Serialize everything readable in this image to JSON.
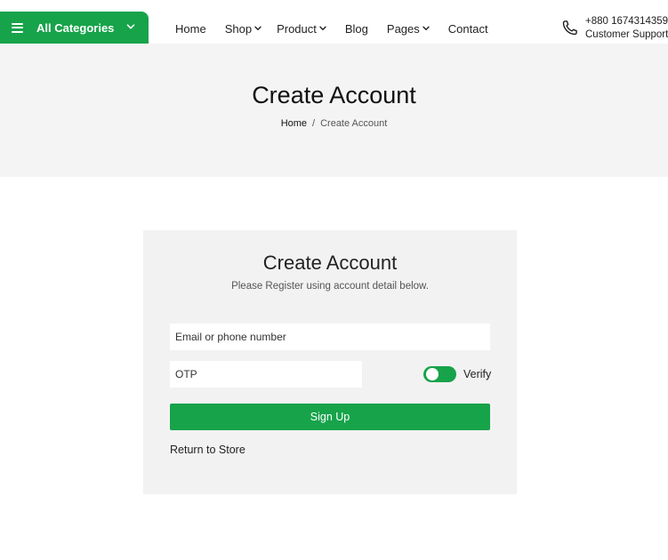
{
  "header": {
    "categories_label": "All Categories",
    "nav": [
      {
        "label": "Home",
        "has_caret": false
      },
      {
        "label": "Shop",
        "has_caret": true
      },
      {
        "label": "Product",
        "has_caret": true
      },
      {
        "label": "Blog",
        "has_caret": false
      },
      {
        "label": "Pages",
        "has_caret": true
      },
      {
        "label": "Contact",
        "has_caret": false
      }
    ],
    "support": {
      "phone": "+880 1674314359",
      "label": "Customer Support",
      "icon": "phone-icon"
    }
  },
  "banner": {
    "title": "Create Account",
    "breadcrumb": {
      "home": "Home",
      "separator": "/",
      "current": "Create Account"
    }
  },
  "form": {
    "title": "Create Account",
    "subtitle": "Please Register using account detail below.",
    "email_placeholder": "Email or phone number",
    "otp_placeholder": "OTP",
    "verify_label": "Verify",
    "verify_on": true,
    "submit_label": "Sign Up",
    "return_label": "Return to Store"
  },
  "colors": {
    "accent": "#17a34a",
    "banner_bg": "#f4f4f4",
    "card_bg": "#f2f2f2"
  }
}
